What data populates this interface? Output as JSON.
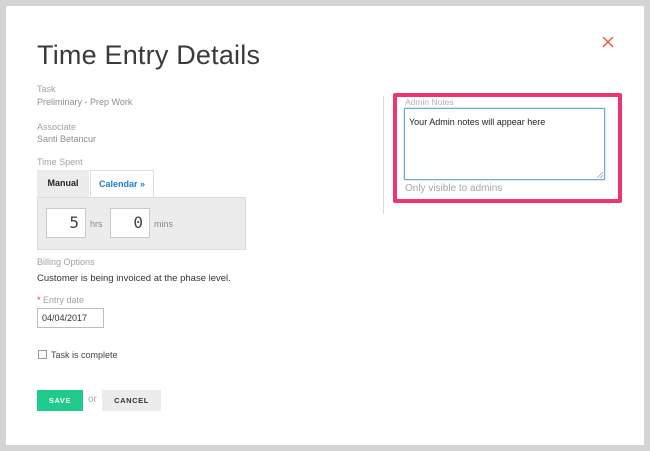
{
  "modal": {
    "title": "Time Entry Details",
    "close_icon": "close-icon",
    "accent_color": "#1ecb8b",
    "highlight_color": "#f0346e"
  },
  "task": {
    "label": "Task",
    "value": "Preliminary - Prep Work"
  },
  "associate": {
    "label": "Associate",
    "value": "Santi Betancur"
  },
  "time_spent": {
    "label": "Time Spent",
    "tabs": [
      {
        "label": "Manual",
        "active": true
      },
      {
        "label": "Calendar »",
        "active": false
      }
    ],
    "hours": "5",
    "hours_unit": "hrs",
    "minutes": "0",
    "minutes_unit": "mins"
  },
  "billing": {
    "label": "Billing Options",
    "value": "Customer is being invoiced at the phase level."
  },
  "entry_date": {
    "required_mark": "*",
    "label": "Entry date",
    "value": "04/04/2017"
  },
  "task_complete": {
    "label": "Task is complete",
    "checked": false
  },
  "actions": {
    "save_label": "SAVE",
    "or_text": "or",
    "cancel_label": "CANCEL"
  },
  "admin_notes": {
    "label": "Admin Notes",
    "value": "Your Admin notes will appear here",
    "hint": "Only visible to admins"
  }
}
